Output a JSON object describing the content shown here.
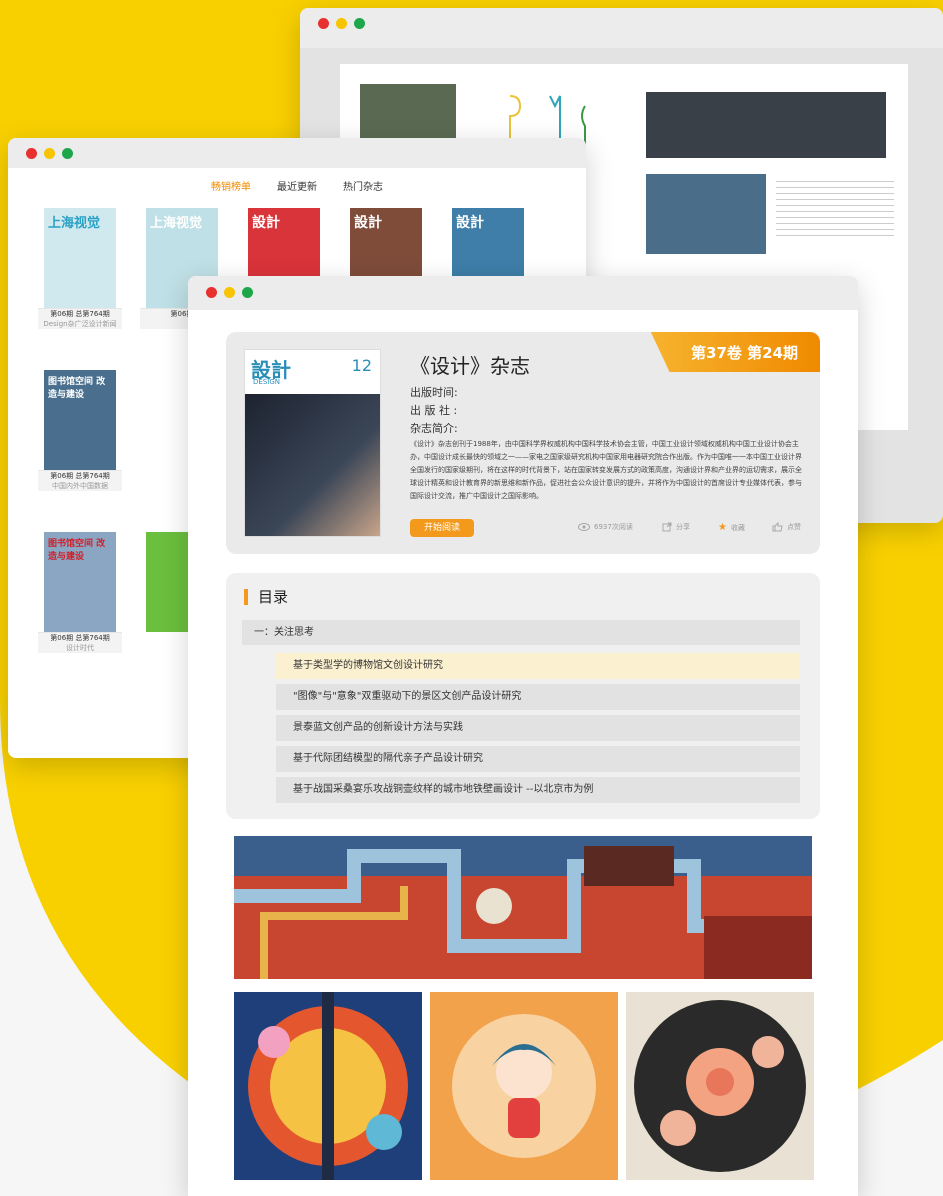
{
  "colors": {
    "accent": "#f39a1c",
    "yellow": "#f6c400",
    "red_dot": "#e8302f",
    "yellow_dot": "#f6c400",
    "green_dot": "#1ea64a"
  },
  "middle_window": {
    "tabs": [
      "畅销榜单",
      "最近更新",
      "热门杂志"
    ],
    "books": [
      {
        "title": "上海视觉",
        "line1": "第06期  总第764期",
        "line2": "Design杂广泛设计新闻"
      },
      {
        "title": "上海视觉",
        "line1": "第06期",
        "line2": ""
      },
      {
        "title": "設計",
        "line1": "",
        "line2": ""
      },
      {
        "title": "設計",
        "line1": "",
        "line2": ""
      },
      {
        "title": "設計",
        "line1": "",
        "line2": ""
      },
      {
        "title": "图书馆空间 改造与建设",
        "line1": "第06期  总第764期",
        "line2": "中国内外中国数据"
      },
      {
        "title": "图书馆空间 改造与建设",
        "line1": "第06期  总第764期",
        "line2": "设计时代"
      }
    ]
  },
  "front_window": {
    "issue_tag": "第37卷 第24期",
    "magazine_title": "《设计》杂志",
    "cover_title": "設計",
    "cover_sub": "DESIGN",
    "cover_issue": "12",
    "publish_time_label": "出版时间:",
    "publisher_label": "出 版 社 :",
    "intro_label": "杂志简介:",
    "description": "《设计》杂志创刊于1988年，由中国科学界权威机构中国科学技术协会主管，中国工业设计领域权威机构中国工业设计协会主办，中国设计成长最快的领域之一——家电之国家级研究机构中国家用电器研究院合作出版。作为中国唯一一本中国工业设计界全国发行的国家级期刊，将在这样的时代背景下，站在国家转变发展方式的政策高度，沟通设计界和产业界的运切需求，展示全球设计精英和设计教育界的新思维和新作品，促进社会公众设计意识的提升，并将作为中国设计的首席设计专业媒体代表，参与国际设计交流，推广中国设计之国际影响。",
    "read_button": "开始阅读",
    "read_count": "6937次阅读",
    "share": "分享",
    "collect": "收藏",
    "like": "点赞",
    "toc_title": "目录",
    "toc_chapter": "一：关注思考",
    "toc_items": [
      "基于类型学的博物馆文创设计研究",
      "\"图像\"与\"意象\"双重驱动下的景区文创产品设计研究",
      "景泰蓝文创产品的创新设计方法与实践",
      "基于代际团结模型的隔代亲子产品设计研究",
      "基于战国采桑宴乐攻战铜壶纹样的城市地铁壁画设计 --以北京市为例"
    ]
  }
}
